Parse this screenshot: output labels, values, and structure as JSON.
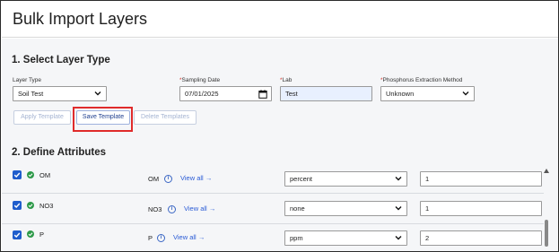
{
  "header": {
    "title": "Bulk Import Layers"
  },
  "section1": {
    "title": "1. Select Layer Type",
    "layer_type": {
      "label": "Layer Type",
      "value": "Soil Test"
    },
    "sampling_date": {
      "required_mark": "*",
      "label": "Sampling Date",
      "value": "07/01/2025"
    },
    "lab": {
      "required_mark": "*",
      "label": "Lab",
      "value": "Test"
    },
    "phosphorus_method": {
      "required_mark": "*",
      "label": "Phosphorus Extraction Method",
      "value": "Unknown"
    },
    "buttons": {
      "apply": "Apply Template",
      "save": "Save Template",
      "delete": "Delete Templates"
    }
  },
  "section2": {
    "title": "2. Define Attributes",
    "view_all_label": "View all",
    "info_glyph": "i",
    "arrow_glyph": "→",
    "rows": [
      {
        "name": "OM",
        "label": "OM",
        "unit": "percent",
        "value": "1"
      },
      {
        "name": "NO3",
        "label": "NO3",
        "unit": "none",
        "value": "1"
      },
      {
        "name": "P",
        "label": "P",
        "unit": "ppm",
        "value": "2"
      }
    ]
  },
  "colors": {
    "accent": "#1f5dcc",
    "link": "#2a5bd6",
    "status_ok": "#2e9a4a",
    "highlight": "#e02b2b",
    "required": "#d0342c"
  }
}
